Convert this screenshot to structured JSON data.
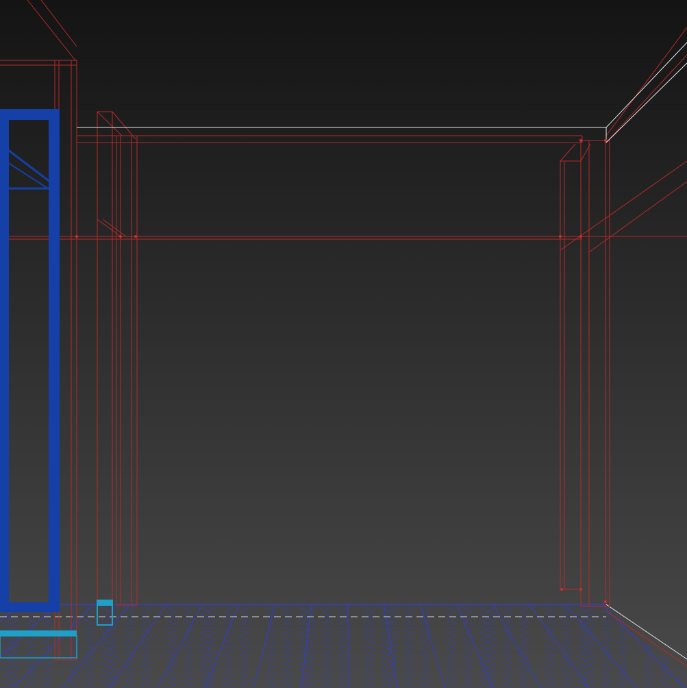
{
  "viewport": {
    "background_top": "#141414",
    "background_bottom": "#4a4a4a",
    "colors": {
      "wire": "#b52a2a",
      "wire_light": "#e8e8e8",
      "selected": "#1440a8",
      "floor": "#2f3fd0",
      "cyan": "#1ea0c8"
    }
  }
}
